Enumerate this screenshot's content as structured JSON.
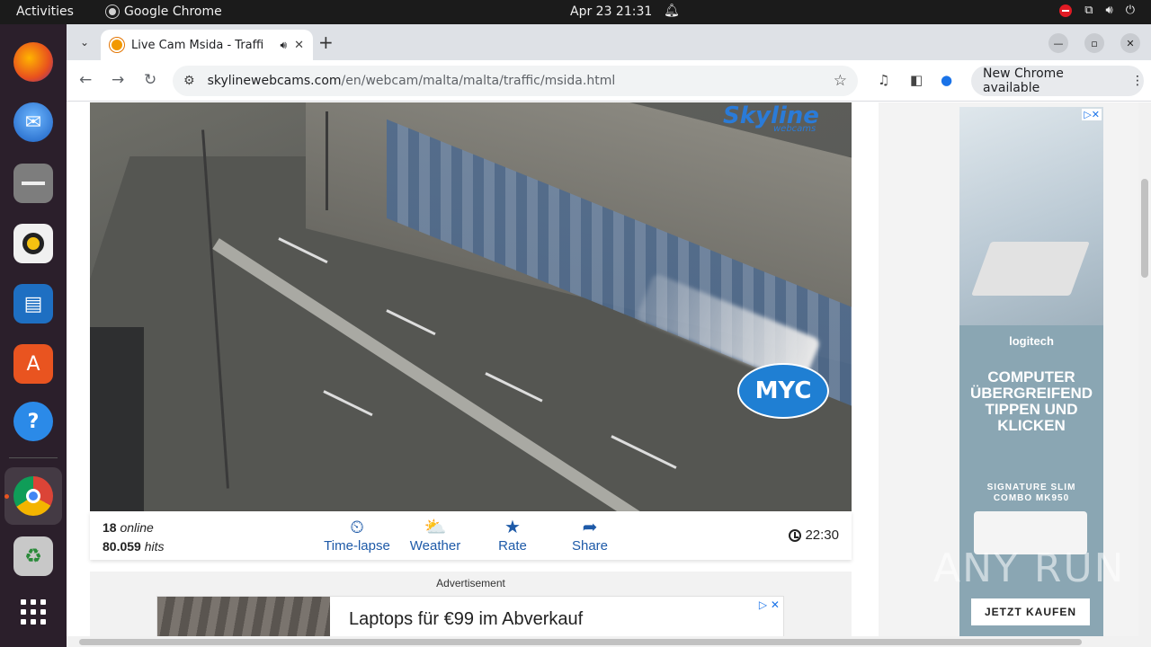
{
  "topbar": {
    "activities": "Activities",
    "app_name": "Google Chrome",
    "clock": "Apr 23  21:31"
  },
  "dock": {
    "items": [
      "firefox-icon",
      "thunderbird-icon",
      "files-icon",
      "rhythmbox-icon",
      "writer-icon",
      "software-icon",
      "help-icon",
      "chrome-icon",
      "trash-icon",
      "apps-grid-icon"
    ]
  },
  "browser": {
    "tab_title": "Live Cam Msida - Traffi",
    "url_host": "skylinewebcams.com",
    "url_path": "/en/webcam/malta/malta/traffic/msida.html",
    "update_label": "New Chrome available"
  },
  "webcam": {
    "logo_text": "Skyline",
    "logo_sub": "webcams",
    "overlay_logo": "MYC",
    "online_count": "18",
    "online_label": "online",
    "hits_count": "80.059",
    "hits_label": "hits",
    "actions": [
      {
        "label": "Time-lapse",
        "icon": "timelapse-icon"
      },
      {
        "label": "Weather",
        "icon": "weather-icon"
      },
      {
        "label": "Rate",
        "icon": "star-icon"
      },
      {
        "label": "Share",
        "icon": "share-icon"
      }
    ],
    "time": "22:30"
  },
  "ad": {
    "label": "Advertisement",
    "banner_text": "Laptops für €99 im Abverkauf"
  },
  "side_ad": {
    "brand": "logitech",
    "headline": "COMPUTER ÜBERGREIFEND TIPPEN UND KLICKEN",
    "product": "SIGNATURE SLIM COMBO MK950",
    "cta": "JETZT KAUFEN"
  },
  "watermark": "ANY RUN"
}
